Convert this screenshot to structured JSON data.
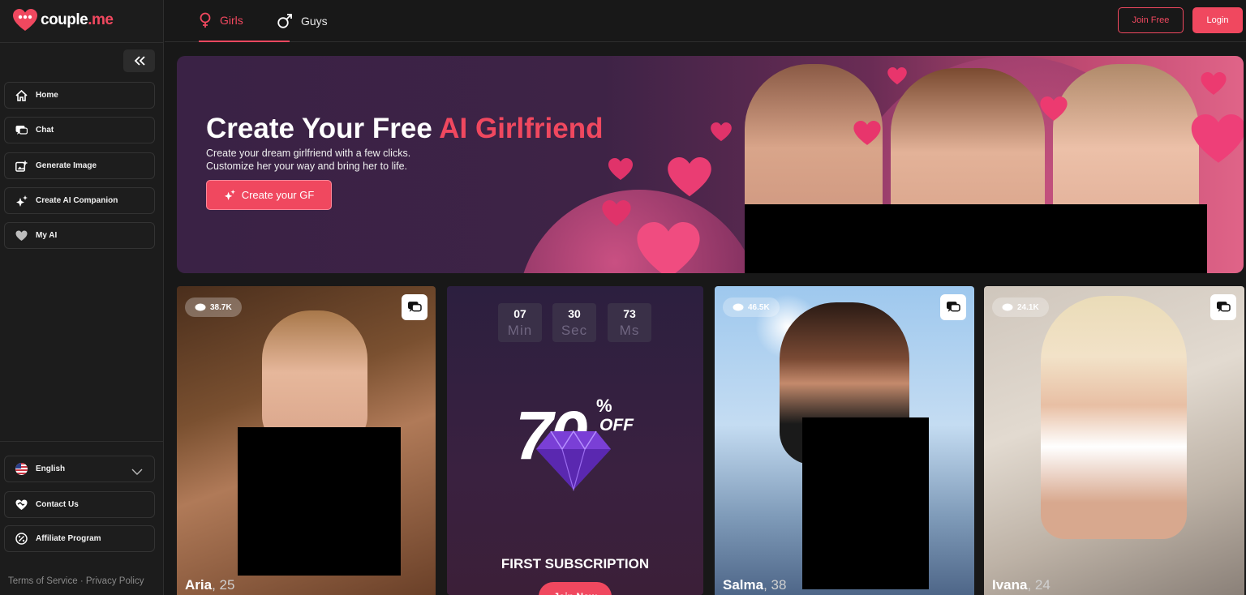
{
  "brand": {
    "name_main": "couple",
    "name_dot": ".me"
  },
  "sidebar": {
    "nav": [
      {
        "label": "Home",
        "icon": "home-icon"
      },
      {
        "label": "Chat",
        "icon": "chat-icon"
      },
      {
        "label": "Generate Image",
        "icon": "image-plus-icon"
      },
      {
        "label": "Create AI Companion",
        "icon": "sparkle-icon"
      },
      {
        "label": "My AI",
        "icon": "heart-icon"
      }
    ],
    "language": {
      "label": "English",
      "icon": "us-flag-icon"
    },
    "bottom": [
      {
        "label": "Contact Us",
        "icon": "handshake-icon"
      },
      {
        "label": "Affiliate Program",
        "icon": "percent-icon"
      }
    ],
    "footer": {
      "terms": "Terms of Service",
      "separator": " · ",
      "privacy": "Privacy Policy"
    }
  },
  "topbar": {
    "tabs": [
      {
        "label": "Girls",
        "active": true
      },
      {
        "label": "Guys",
        "active": false
      }
    ],
    "join_label": "Join Free",
    "login_label": "Login"
  },
  "banner": {
    "title_main": "Create Your Free ",
    "title_accent": "AI Girlfriend",
    "subtitle_line1": "Create your dream girlfriend with a few clicks.",
    "subtitle_line2": "Customize her your way and bring her to life.",
    "cta_label": "Create your GF"
  },
  "cards": [
    {
      "name": "Aria",
      "age": ", 25",
      "views": "38.7K"
    },
    {
      "name": "Salma",
      "age": ", 38",
      "views": "46.5K"
    },
    {
      "name": "Ivana",
      "age": ", 24",
      "views": "24.1K"
    }
  ],
  "promo": {
    "timer": [
      {
        "value": "07",
        "unit": "Min"
      },
      {
        "value": "30",
        "unit": "Sec"
      },
      {
        "value": "73",
        "unit": "Ms"
      }
    ],
    "discount": "70",
    "percent": "%",
    "off": "OFF",
    "headline": "FIRST SUBSCRIPTION",
    "button_label": "Join Now"
  },
  "colors": {
    "accent": "#f0485f",
    "sidebar_bg": "#1c1c1c",
    "page_bg": "#181818"
  }
}
